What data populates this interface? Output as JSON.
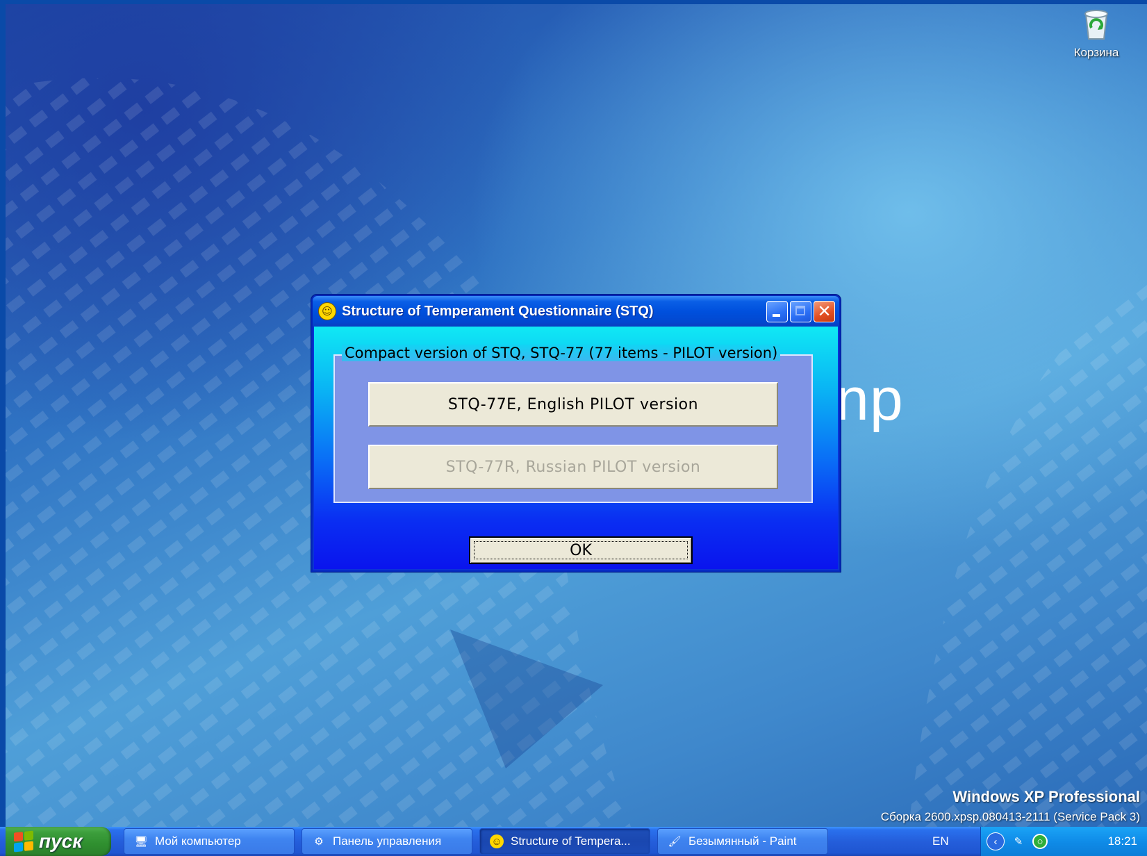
{
  "desktop": {
    "recycle_bin_label": "Корзина",
    "background_text": "np",
    "edition": "Windows XP Professional",
    "build": "Сборка 2600.xpsp.080413-2111 (Service Pack 3)"
  },
  "dialog": {
    "title": "Structure of Temperament Questionnaire (STQ)",
    "group_label": "Compact version of STQ, STQ-77 (77 items - PILOT version)",
    "options": [
      {
        "label": "STQ-77E, English PILOT version",
        "enabled": true
      },
      {
        "label": "STQ-77R, Russian PILOT version",
        "enabled": false
      }
    ],
    "ok_label": "OK"
  },
  "taskbar": {
    "start_label": "пуск",
    "tasks": [
      {
        "label": "Мой компьютер",
        "icon": "my-computer-icon",
        "active": false
      },
      {
        "label": "Панель управления",
        "icon": "control-panel-icon",
        "active": false
      },
      {
        "label": "Structure of Tempera...",
        "icon": "smiley-icon",
        "active": true
      },
      {
        "label": "Безымянный - Paint",
        "icon": "paint-icon",
        "active": false
      }
    ],
    "language": "EN",
    "clock": "18:21"
  },
  "colors": {
    "titlebar": "#0050dd",
    "client_top": "#10e8f4",
    "client_bottom": "#0a14ee",
    "groupbox": "#7f94e6",
    "button_face": "#ece9d8",
    "start_green": "#3c9e3c"
  }
}
